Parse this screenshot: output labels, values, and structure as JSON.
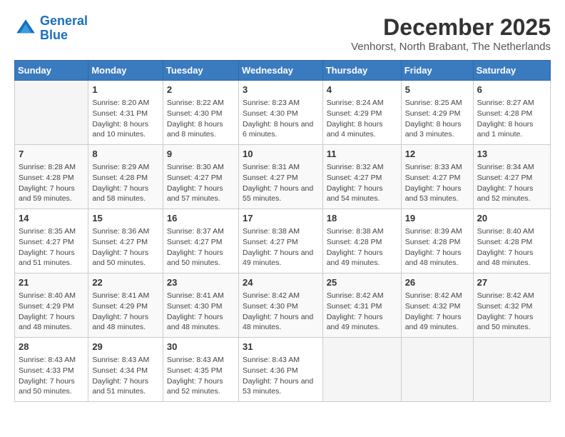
{
  "header": {
    "logo_line1": "General",
    "logo_line2": "Blue",
    "month_year": "December 2025",
    "location": "Venhorst, North Brabant, The Netherlands"
  },
  "days_of_week": [
    "Sunday",
    "Monday",
    "Tuesday",
    "Wednesday",
    "Thursday",
    "Friday",
    "Saturday"
  ],
  "weeks": [
    [
      {
        "day": "",
        "sunrise": "",
        "sunset": "",
        "daylight": ""
      },
      {
        "day": "1",
        "sunrise": "Sunrise: 8:20 AM",
        "sunset": "Sunset: 4:31 PM",
        "daylight": "Daylight: 8 hours and 10 minutes."
      },
      {
        "day": "2",
        "sunrise": "Sunrise: 8:22 AM",
        "sunset": "Sunset: 4:30 PM",
        "daylight": "Daylight: 8 hours and 8 minutes."
      },
      {
        "day": "3",
        "sunrise": "Sunrise: 8:23 AM",
        "sunset": "Sunset: 4:30 PM",
        "daylight": "Daylight: 8 hours and 6 minutes."
      },
      {
        "day": "4",
        "sunrise": "Sunrise: 8:24 AM",
        "sunset": "Sunset: 4:29 PM",
        "daylight": "Daylight: 8 hours and 4 minutes."
      },
      {
        "day": "5",
        "sunrise": "Sunrise: 8:25 AM",
        "sunset": "Sunset: 4:29 PM",
        "daylight": "Daylight: 8 hours and 3 minutes."
      },
      {
        "day": "6",
        "sunrise": "Sunrise: 8:27 AM",
        "sunset": "Sunset: 4:28 PM",
        "daylight": "Daylight: 8 hours and 1 minute."
      }
    ],
    [
      {
        "day": "7",
        "sunrise": "Sunrise: 8:28 AM",
        "sunset": "Sunset: 4:28 PM",
        "daylight": "Daylight: 7 hours and 59 minutes."
      },
      {
        "day": "8",
        "sunrise": "Sunrise: 8:29 AM",
        "sunset": "Sunset: 4:28 PM",
        "daylight": "Daylight: 7 hours and 58 minutes."
      },
      {
        "day": "9",
        "sunrise": "Sunrise: 8:30 AM",
        "sunset": "Sunset: 4:27 PM",
        "daylight": "Daylight: 7 hours and 57 minutes."
      },
      {
        "day": "10",
        "sunrise": "Sunrise: 8:31 AM",
        "sunset": "Sunset: 4:27 PM",
        "daylight": "Daylight: 7 hours and 55 minutes."
      },
      {
        "day": "11",
        "sunrise": "Sunrise: 8:32 AM",
        "sunset": "Sunset: 4:27 PM",
        "daylight": "Daylight: 7 hours and 54 minutes."
      },
      {
        "day": "12",
        "sunrise": "Sunrise: 8:33 AM",
        "sunset": "Sunset: 4:27 PM",
        "daylight": "Daylight: 7 hours and 53 minutes."
      },
      {
        "day": "13",
        "sunrise": "Sunrise: 8:34 AM",
        "sunset": "Sunset: 4:27 PM",
        "daylight": "Daylight: 7 hours and 52 minutes."
      }
    ],
    [
      {
        "day": "14",
        "sunrise": "Sunrise: 8:35 AM",
        "sunset": "Sunset: 4:27 PM",
        "daylight": "Daylight: 7 hours and 51 minutes."
      },
      {
        "day": "15",
        "sunrise": "Sunrise: 8:36 AM",
        "sunset": "Sunset: 4:27 PM",
        "daylight": "Daylight: 7 hours and 50 minutes."
      },
      {
        "day": "16",
        "sunrise": "Sunrise: 8:37 AM",
        "sunset": "Sunset: 4:27 PM",
        "daylight": "Daylight: 7 hours and 50 minutes."
      },
      {
        "day": "17",
        "sunrise": "Sunrise: 8:38 AM",
        "sunset": "Sunset: 4:27 PM",
        "daylight": "Daylight: 7 hours and 49 minutes."
      },
      {
        "day": "18",
        "sunrise": "Sunrise: 8:38 AM",
        "sunset": "Sunset: 4:28 PM",
        "daylight": "Daylight: 7 hours and 49 minutes."
      },
      {
        "day": "19",
        "sunrise": "Sunrise: 8:39 AM",
        "sunset": "Sunset: 4:28 PM",
        "daylight": "Daylight: 7 hours and 48 minutes."
      },
      {
        "day": "20",
        "sunrise": "Sunrise: 8:40 AM",
        "sunset": "Sunset: 4:28 PM",
        "daylight": "Daylight: 7 hours and 48 minutes."
      }
    ],
    [
      {
        "day": "21",
        "sunrise": "Sunrise: 8:40 AM",
        "sunset": "Sunset: 4:29 PM",
        "daylight": "Daylight: 7 hours and 48 minutes."
      },
      {
        "day": "22",
        "sunrise": "Sunrise: 8:41 AM",
        "sunset": "Sunset: 4:29 PM",
        "daylight": "Daylight: 7 hours and 48 minutes."
      },
      {
        "day": "23",
        "sunrise": "Sunrise: 8:41 AM",
        "sunset": "Sunset: 4:30 PM",
        "daylight": "Daylight: 7 hours and 48 minutes."
      },
      {
        "day": "24",
        "sunrise": "Sunrise: 8:42 AM",
        "sunset": "Sunset: 4:30 PM",
        "daylight": "Daylight: 7 hours and 48 minutes."
      },
      {
        "day": "25",
        "sunrise": "Sunrise: 8:42 AM",
        "sunset": "Sunset: 4:31 PM",
        "daylight": "Daylight: 7 hours and 49 minutes."
      },
      {
        "day": "26",
        "sunrise": "Sunrise: 8:42 AM",
        "sunset": "Sunset: 4:32 PM",
        "daylight": "Daylight: 7 hours and 49 minutes."
      },
      {
        "day": "27",
        "sunrise": "Sunrise: 8:42 AM",
        "sunset": "Sunset: 4:32 PM",
        "daylight": "Daylight: 7 hours and 50 minutes."
      }
    ],
    [
      {
        "day": "28",
        "sunrise": "Sunrise: 8:43 AM",
        "sunset": "Sunset: 4:33 PM",
        "daylight": "Daylight: 7 hours and 50 minutes."
      },
      {
        "day": "29",
        "sunrise": "Sunrise: 8:43 AM",
        "sunset": "Sunset: 4:34 PM",
        "daylight": "Daylight: 7 hours and 51 minutes."
      },
      {
        "day": "30",
        "sunrise": "Sunrise: 8:43 AM",
        "sunset": "Sunset: 4:35 PM",
        "daylight": "Daylight: 7 hours and 52 minutes."
      },
      {
        "day": "31",
        "sunrise": "Sunrise: 8:43 AM",
        "sunset": "Sunset: 4:36 PM",
        "daylight": "Daylight: 7 hours and 53 minutes."
      },
      {
        "day": "",
        "sunrise": "",
        "sunset": "",
        "daylight": ""
      },
      {
        "day": "",
        "sunrise": "",
        "sunset": "",
        "daylight": ""
      },
      {
        "day": "",
        "sunrise": "",
        "sunset": "",
        "daylight": ""
      }
    ]
  ]
}
